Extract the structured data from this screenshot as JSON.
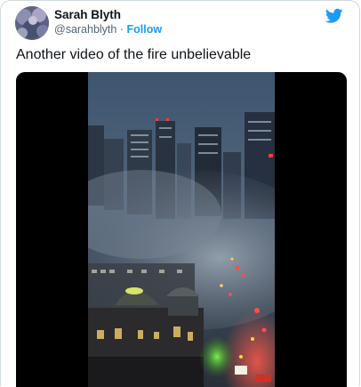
{
  "author": {
    "display_name": "Sarah Blyth",
    "handle": "@sarahblyth",
    "separator": "·",
    "follow_label": "Follow",
    "avatar_icon": "avatar-image",
    "brand_icon": "twitter-bird-icon"
  },
  "tweet": {
    "text": "Another video of the fire unbelievable"
  },
  "media": {
    "type": "video",
    "description_icon": "video-thumbnail"
  },
  "colors": {
    "accent": "#1d9bf0",
    "text": "#0f1419",
    "muted": "#536471",
    "border": "#cfd9de"
  }
}
